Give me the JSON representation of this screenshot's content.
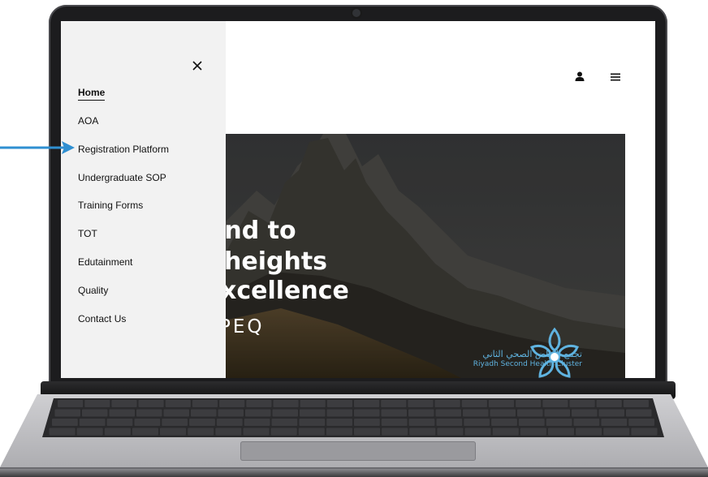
{
  "nav": {
    "items": [
      {
        "label": "Home",
        "active": true
      },
      {
        "label": "AOA",
        "active": false
      },
      {
        "label": "Registration Platform",
        "active": false
      },
      {
        "label": "Undergraduate SOP",
        "active": false
      },
      {
        "label": "Training Forms",
        "active": false
      },
      {
        "label": "TOT",
        "active": false
      },
      {
        "label": "Edutainment",
        "active": false
      },
      {
        "label": "Quality",
        "active": false
      },
      {
        "label": "Contact Us",
        "active": false
      }
    ]
  },
  "hero": {
    "line1": "end to",
    "line2": "heights",
    "line3": "xcellence",
    "line4": "PEQ"
  },
  "logo": {
    "arabic": "تجمع الرياض الصحي الثاني",
    "english": "Riyadh Second Health Cluster"
  },
  "colors": {
    "annotation_arrow": "#2f8fd1",
    "logo": "#5fb3e0",
    "sidebar_bg": "#f2f2f2"
  },
  "icons": {
    "close": "close-icon",
    "user": "user-icon",
    "menu": "hamburger-menu-icon",
    "arrow": "arrow-right-icon"
  }
}
